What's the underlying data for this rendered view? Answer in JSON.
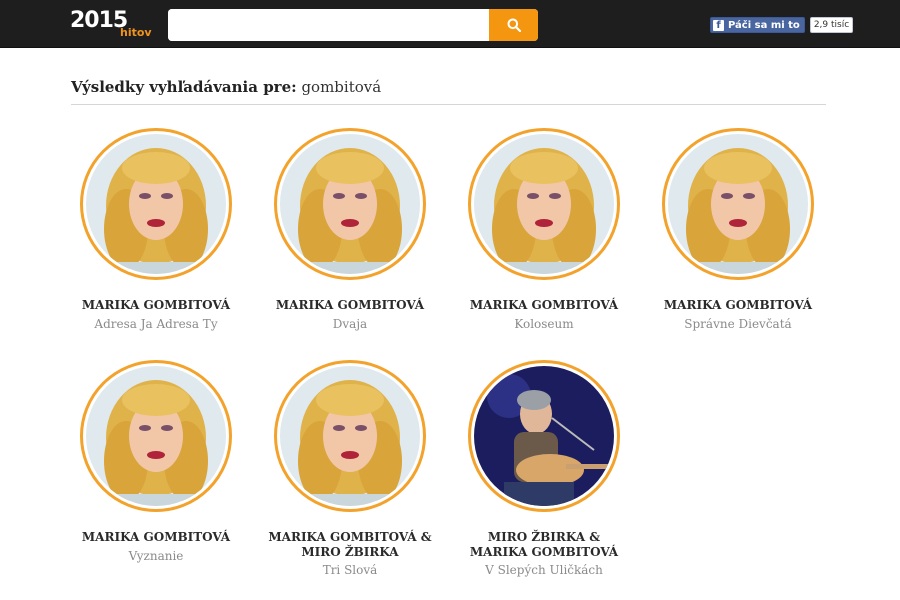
{
  "header": {
    "logo_year": "2015",
    "logo_sub": "hitov",
    "search": {
      "value": "",
      "placeholder": ""
    },
    "search_icon": "search-icon",
    "facebook": {
      "like_label": "Páči sa mi to",
      "count": "2,9 tisíc"
    }
  },
  "results": {
    "heading_label": "Výsledky vyhľadávania pre:",
    "query": "gombitová",
    "items": [
      {
        "artist": "MARIKA GOMBITOVÁ",
        "song": "Adresa Ja Adresa Ty",
        "photo": "marika"
      },
      {
        "artist": "MARIKA GOMBITOVÁ",
        "song": "Dvaja",
        "photo": "marika"
      },
      {
        "artist": "MARIKA GOMBITOVÁ",
        "song": "Koloseum",
        "photo": "marika"
      },
      {
        "artist": "MARIKA GOMBITOVÁ",
        "song": "Správne Dievčatá",
        "photo": "marika"
      },
      {
        "artist": "MARIKA GOMBITOVÁ",
        "song": "Vyznanie",
        "photo": "marika"
      },
      {
        "artist": "MARIKA GOMBITOVÁ & MIRO ŽBIRKA",
        "song": "Tri Slová",
        "photo": "marika"
      },
      {
        "artist": "MIRO ŽBIRKA & MARIKA GOMBITOVÁ",
        "song": "V Slepých Uličkách",
        "photo": "miro"
      }
    ]
  },
  "colors": {
    "topbar": "#1e1e1e",
    "accent": "#f4960f",
    "ring": "#f3a22b",
    "facebook": "#4a66a0"
  }
}
